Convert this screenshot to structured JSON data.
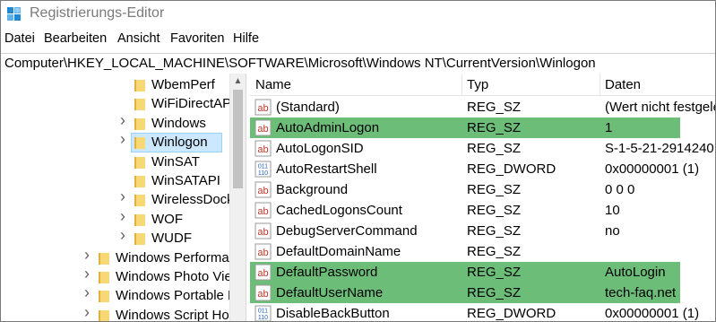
{
  "window": {
    "title": "Registrierungs-Editor"
  },
  "menu": [
    "Datei",
    "Bearbeiten",
    "Ansicht",
    "Favoriten",
    "Hilfe"
  ],
  "address": "Computer\\HKEY_LOCAL_MACHINE\\SOFTWARE\\Microsoft\\Windows NT\\CurrentVersion\\Winlogon",
  "tree": {
    "items": [
      {
        "label": "WbemPerf",
        "expandable": false
      },
      {
        "label": "WiFiDirectAPI",
        "expandable": false
      },
      {
        "label": "Windows",
        "expandable": true
      },
      {
        "label": "Winlogon",
        "expandable": true,
        "selected": true
      },
      {
        "label": "WinSAT",
        "expandable": false
      },
      {
        "label": "WinSATAPI",
        "expandable": false
      },
      {
        "label": "WirelessDocking",
        "expandable": true
      },
      {
        "label": "WOF",
        "expandable": true
      },
      {
        "label": "WUDF",
        "expandable": true
      },
      {
        "label": "Windows Performance",
        "expandable": true
      },
      {
        "label": "Windows Photo Viewer",
        "expandable": true
      },
      {
        "label": "Windows Portable Devices",
        "expandable": true
      },
      {
        "label": "Windows Script Host",
        "expandable": true
      }
    ]
  },
  "list": {
    "columns": [
      "Name",
      "Typ",
      "Daten"
    ],
    "rows": [
      {
        "name": "(Standard)",
        "type": "REG_SZ",
        "data": "(Wert nicht festgelegt)",
        "icon": "string-value-icon",
        "highlight": false
      },
      {
        "name": "AutoAdminLogon",
        "type": "REG_SZ",
        "data": "1",
        "icon": "string-value-icon",
        "highlight": true
      },
      {
        "name": "AutoLogonSID",
        "type": "REG_SZ",
        "data": "S-1-5-21-2914240",
        "icon": "string-value-icon",
        "highlight": false
      },
      {
        "name": "AutoRestartShell",
        "type": "REG_DWORD",
        "data": "0x00000001 (1)",
        "icon": "binary-value-icon",
        "highlight": false
      },
      {
        "name": "Background",
        "type": "REG_SZ",
        "data": "0 0 0",
        "icon": "string-value-icon",
        "highlight": false
      },
      {
        "name": "CachedLogonsCount",
        "type": "REG_SZ",
        "data": "10",
        "icon": "string-value-icon",
        "highlight": false
      },
      {
        "name": "DebugServerCommand",
        "type": "REG_SZ",
        "data": "no",
        "icon": "string-value-icon",
        "highlight": false
      },
      {
        "name": "DefaultDomainName",
        "type": "REG_SZ",
        "data": "",
        "icon": "string-value-icon",
        "highlight": false
      },
      {
        "name": "DefaultPassword",
        "type": "REG_SZ",
        "data": "AutoLogin",
        "icon": "string-value-icon",
        "highlight": true
      },
      {
        "name": "DefaultUserName",
        "type": "REG_SZ",
        "data": "tech-faq.net",
        "icon": "string-value-icon",
        "highlight": true
      },
      {
        "name": "DisableBackButton",
        "type": "REG_DWORD",
        "data": "0x00000001 (1)",
        "icon": "binary-value-icon",
        "highlight": false
      }
    ]
  },
  "colors": {
    "highlight": "#6cbd77",
    "selection": "#cce8ff",
    "folder": "#f8d775"
  }
}
